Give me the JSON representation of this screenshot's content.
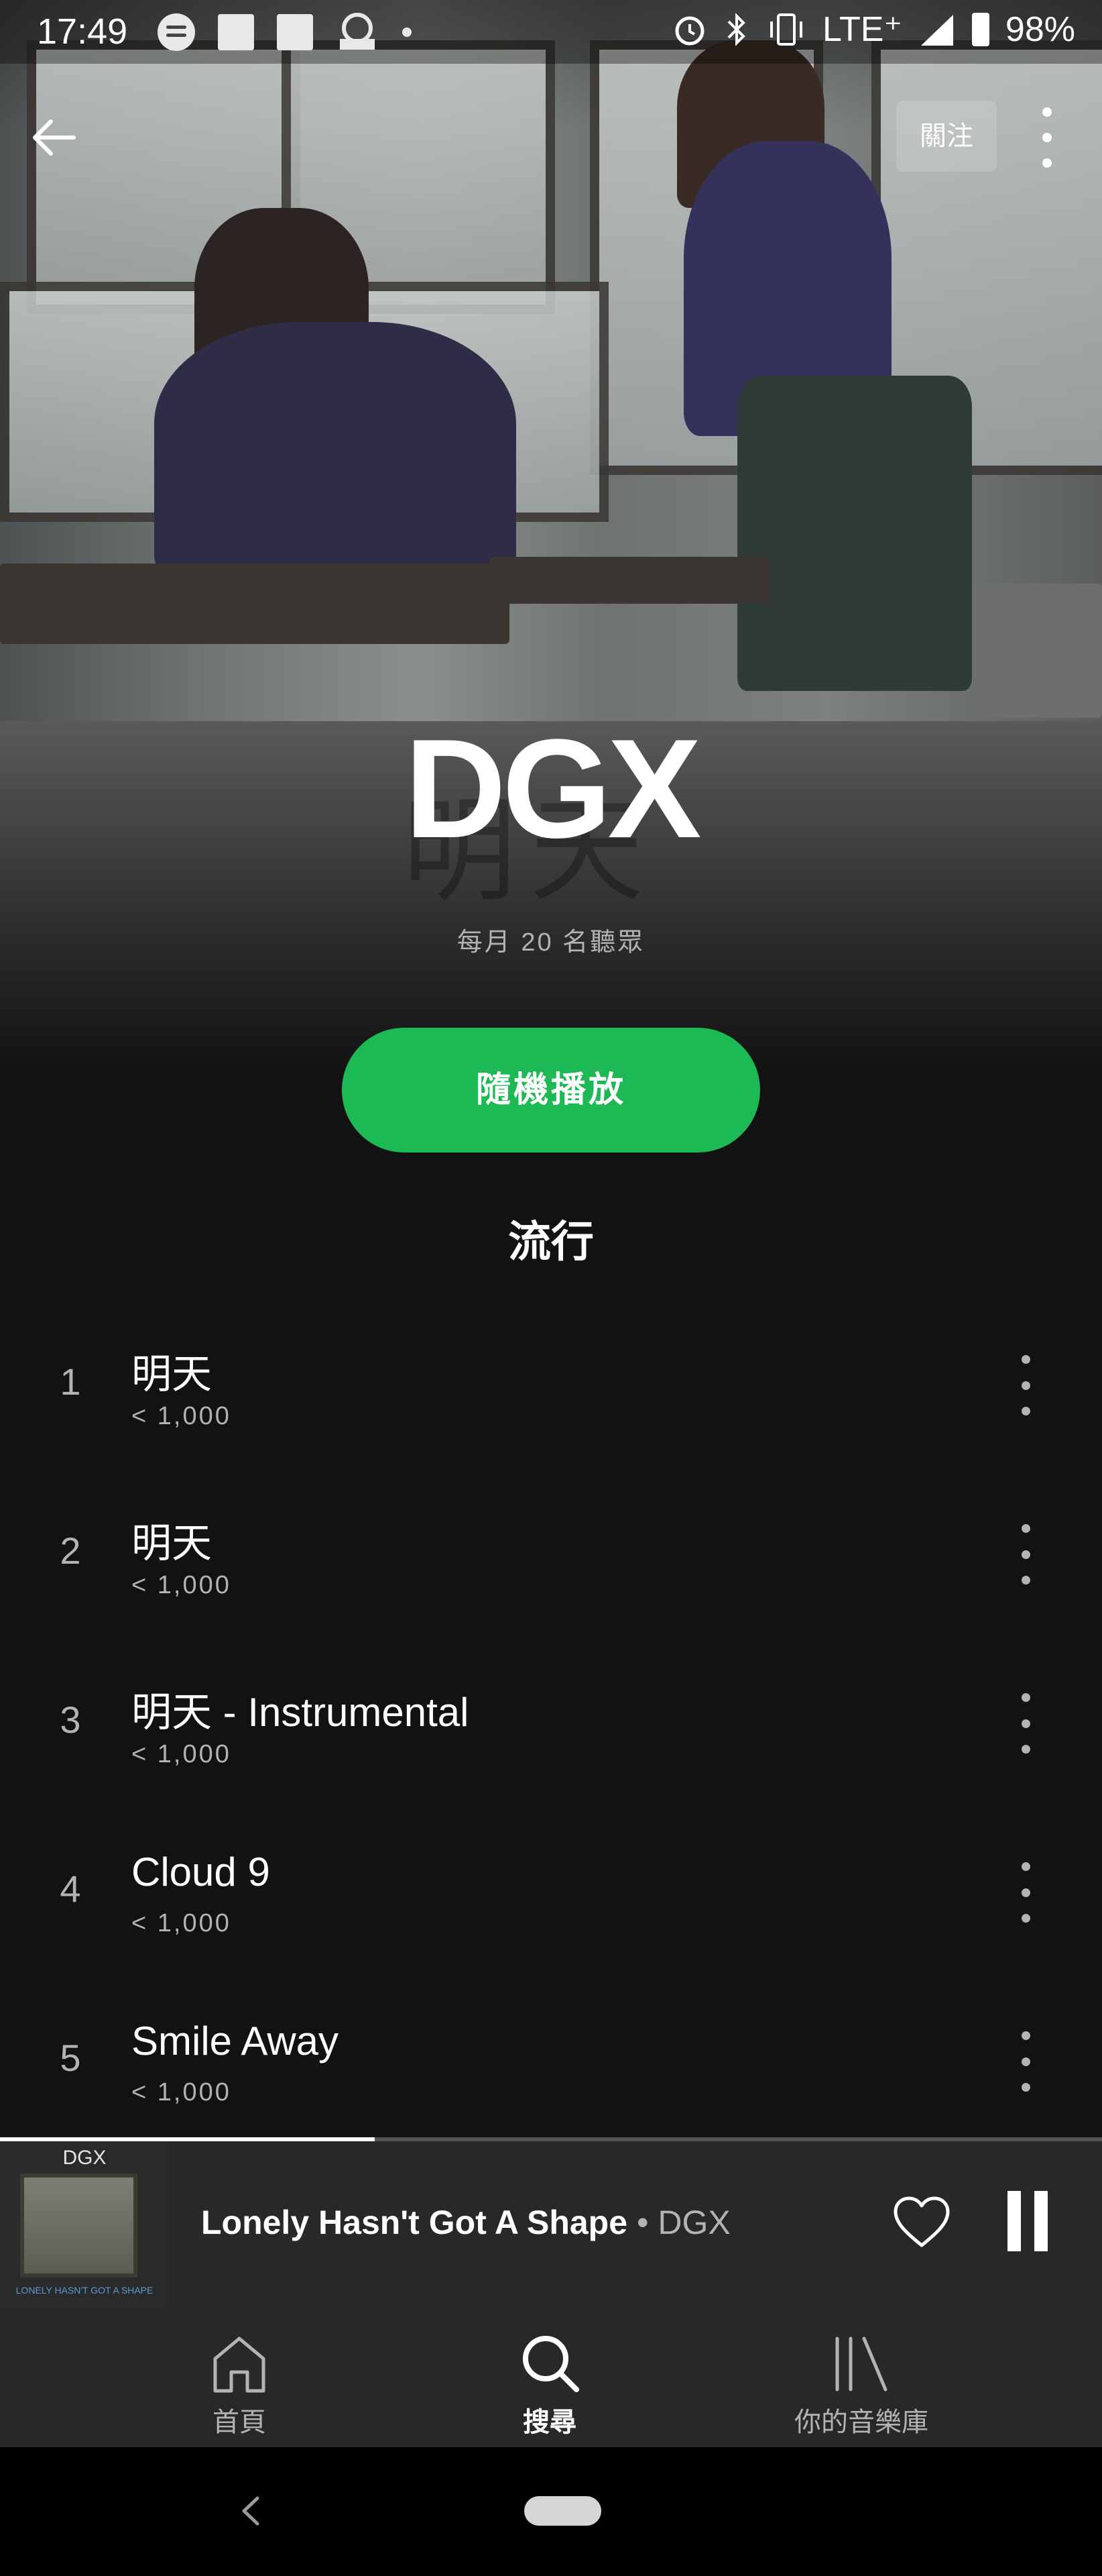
{
  "status_bar": {
    "time": "17:49",
    "network": "LTE⁺",
    "battery": "98%",
    "icons": [
      "spotify-icon",
      "notification-square-icon",
      "notification-square-icon",
      "now-app-icon",
      "dot-icon",
      "alarm-icon",
      "bluetooth-icon",
      "vibrate-icon",
      "signal-icon",
      "battery-icon"
    ]
  },
  "header": {
    "back_icon": "arrow-left-icon",
    "follow_label": "關注",
    "more_icon": "more-vertical-icon"
  },
  "artist": {
    "name": "DGX",
    "monthly_listeners": "每月 20 名聽眾"
  },
  "shuffle_label": "隨機播放",
  "popular_title": "流行",
  "tracks": [
    {
      "num": "1",
      "title": "明天",
      "plays": "< 1,000"
    },
    {
      "num": "2",
      "title": "明天",
      "plays": "< 1,000"
    },
    {
      "num": "3",
      "title": "明天 - Instrumental",
      "plays": "< 1,000"
    },
    {
      "num": "4",
      "title": "Cloud 9",
      "plays": "< 1,000"
    },
    {
      "num": "5",
      "title": "Smile Away",
      "plays": "< 1,000"
    }
  ],
  "now_playing": {
    "cover_label": "DGX",
    "title": "Lonely Hasn't Got A Shape",
    "separator": "•",
    "artist": "DGX",
    "progress": 0.34,
    "icons": [
      "heart-icon",
      "pause-icon"
    ]
  },
  "bottom_nav": [
    {
      "label": "首頁",
      "icon": "home-icon",
      "active": false
    },
    {
      "label": "搜尋",
      "icon": "search-icon",
      "active": true
    },
    {
      "label": "你的音樂庫",
      "icon": "library-icon",
      "active": false
    }
  ],
  "colors": {
    "accent": "#1db954",
    "background": "#121212",
    "bar": "#282828",
    "secondary_text": "#b3b3b3"
  }
}
